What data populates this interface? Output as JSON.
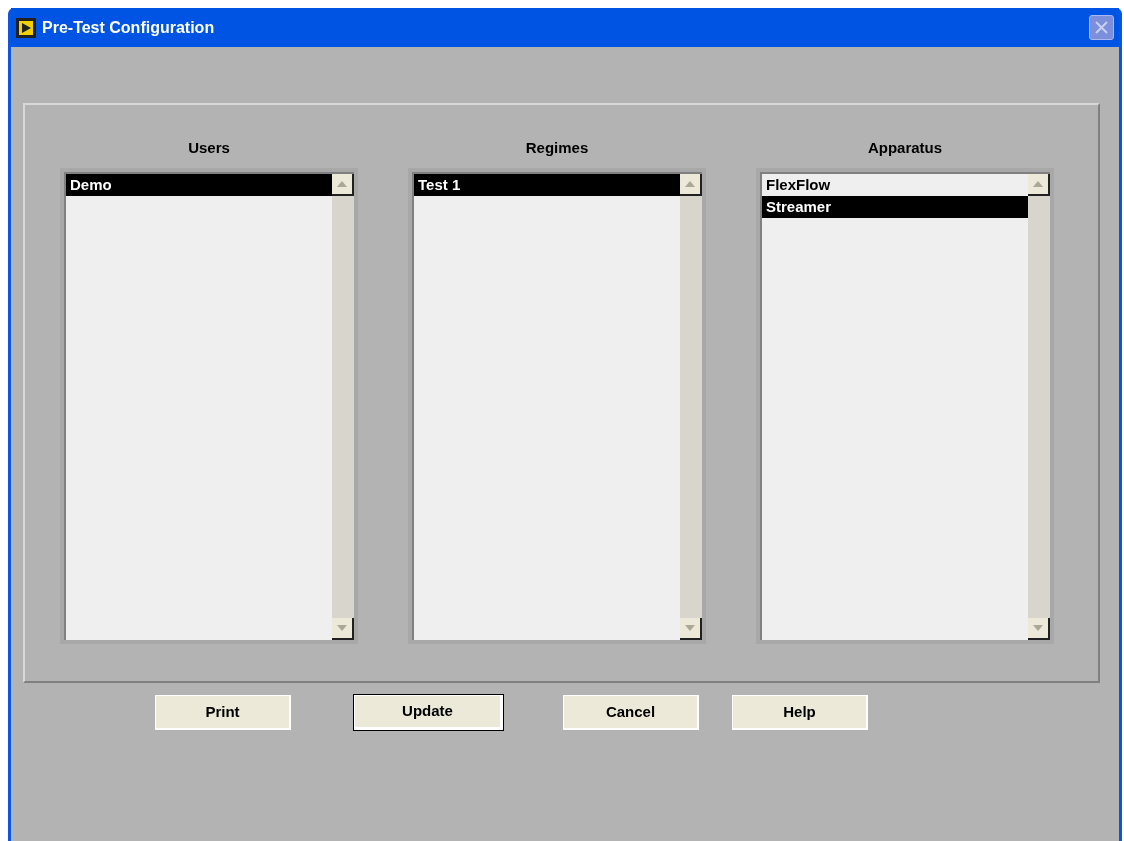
{
  "window": {
    "title": "Pre-Test Configuration"
  },
  "lists": [
    {
      "label": "Users",
      "items": [
        {
          "text": "Demo",
          "selected": true
        }
      ]
    },
    {
      "label": "Regimes",
      "items": [
        {
          "text": "Test 1",
          "selected": true
        }
      ]
    },
    {
      "label": "Apparatus",
      "items": [
        {
          "text": "FlexFlow",
          "selected": false
        },
        {
          "text": "Streamer",
          "selected": true
        }
      ]
    }
  ],
  "buttons": [
    {
      "label": "Print",
      "default": false
    },
    {
      "label": "Update",
      "default": true
    },
    {
      "label": "Cancel",
      "default": false
    },
    {
      "label": "Help",
      "default": false
    }
  ]
}
